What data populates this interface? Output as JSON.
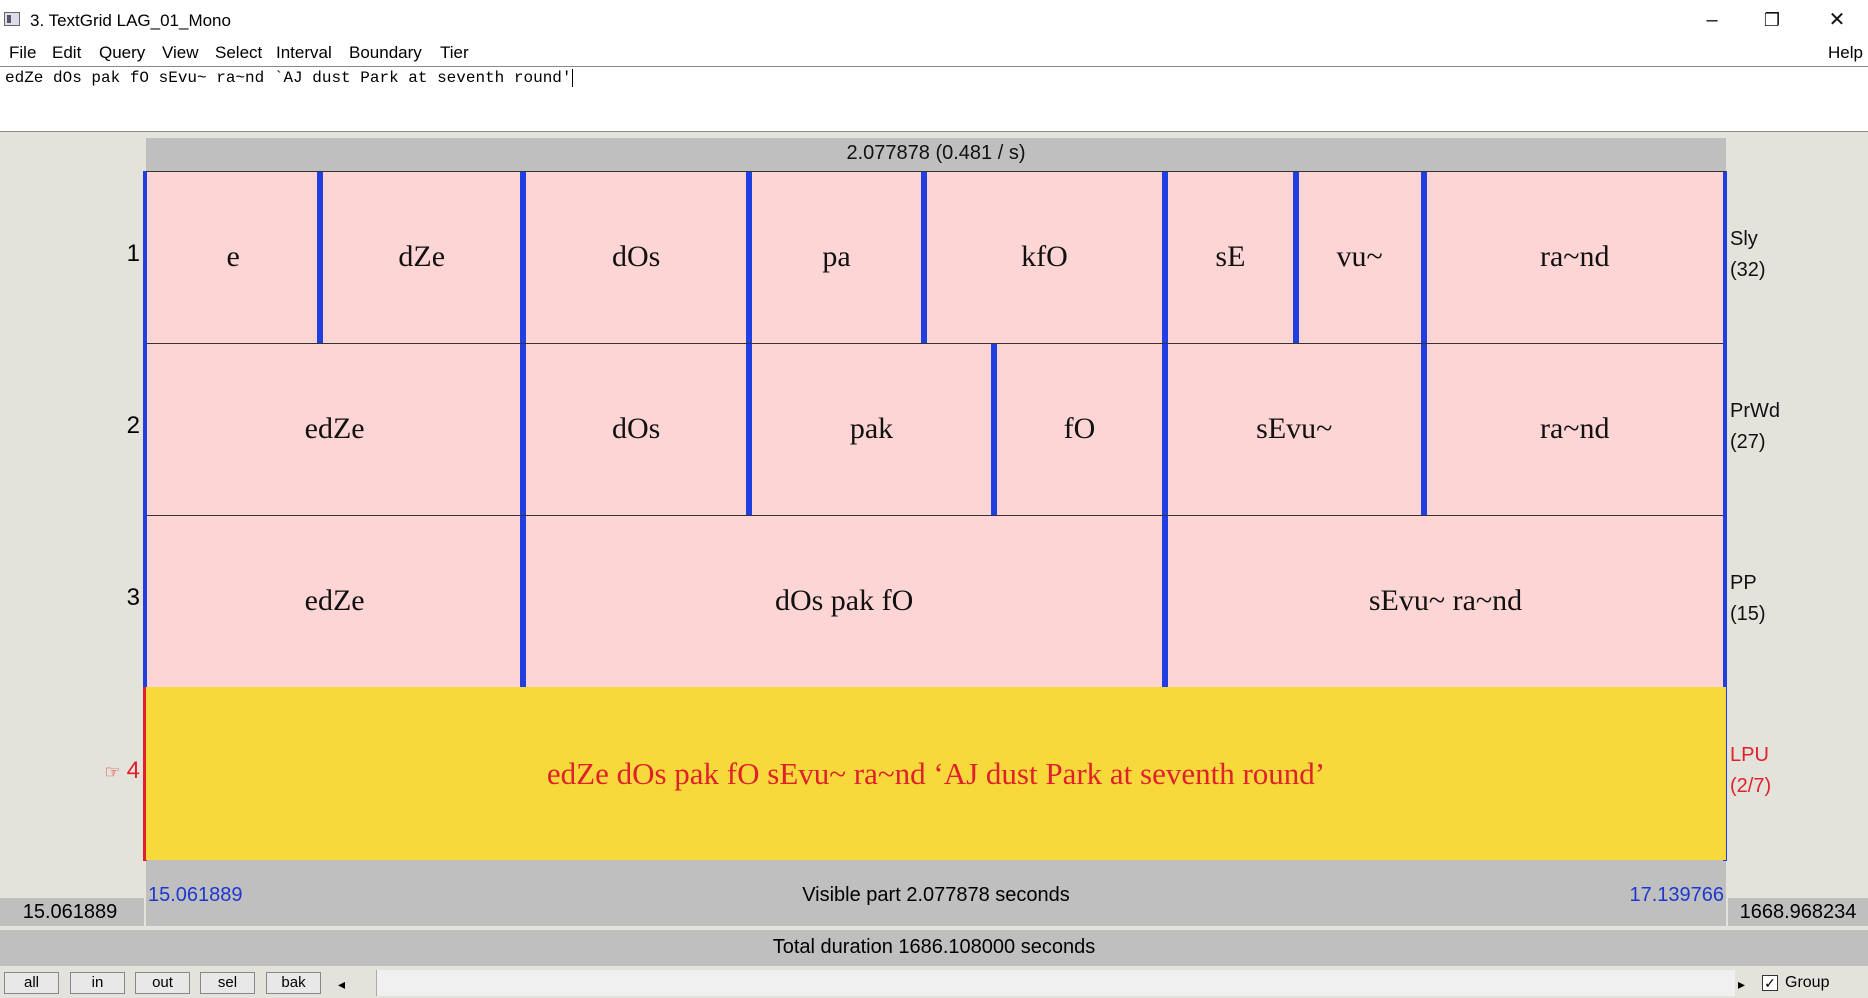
{
  "window": {
    "title": "3. TextGrid LAG_01_Mono",
    "minimize": "–",
    "restore": "❐",
    "close": "✕",
    "help": "Help"
  },
  "menu": [
    "File",
    "Edit",
    "Query",
    "View",
    "Select",
    "Interval",
    "Boundary",
    "Tier"
  ],
  "textbox": {
    "value": "edZe dOs pak fO sEvu~ ra~nd `AJ dust Park at seventh round'"
  },
  "header": {
    "duration_label": "2.077878 (0.481 / s)"
  },
  "tiers": [
    {
      "number": "1",
      "name": "Sly",
      "count": "(32)",
      "intervals": [
        {
          "text": "e",
          "start": 15.061889,
          "end": 15.291
        },
        {
          "text": "dZe",
          "start": 15.291,
          "end": 15.558
        },
        {
          "text": "dOs",
          "start": 15.558,
          "end": 15.855
        },
        {
          "text": "pa",
          "start": 15.855,
          "end": 16.085
        },
        {
          "text": "kfO",
          "start": 16.085,
          "end": 16.402
        },
        {
          "text": "sE",
          "start": 16.402,
          "end": 16.574
        },
        {
          "text": "vu~",
          "start": 16.574,
          "end": 16.742
        },
        {
          "text": "ra~nd",
          "start": 16.742,
          "end": 17.139766
        }
      ]
    },
    {
      "number": "2",
      "name": "PrWd",
      "count": "(27)",
      "intervals": [
        {
          "text": "edZe",
          "start": 15.061889,
          "end": 15.558
        },
        {
          "text": "dOs",
          "start": 15.558,
          "end": 15.855
        },
        {
          "text": "pak",
          "start": 15.855,
          "end": 16.177
        },
        {
          "text": "fO",
          "start": 16.177,
          "end": 16.402
        },
        {
          "text": "sEvu~",
          "start": 16.402,
          "end": 16.742
        },
        {
          "text": "ra~nd",
          "start": 16.742,
          "end": 17.139766
        }
      ]
    },
    {
      "number": "3",
      "name": "PP",
      "count": "(15)",
      "intervals": [
        {
          "text": "edZe",
          "start": 15.061889,
          "end": 15.558
        },
        {
          "text": "dOs pak fO",
          "start": 15.558,
          "end": 16.402
        },
        {
          "text": "sEvu~ ra~nd",
          "start": 16.402,
          "end": 17.139766
        }
      ]
    },
    {
      "number": "4",
      "name": "LPU",
      "count": "(2/7)",
      "selected": true,
      "pointer": "☞",
      "intervals": [
        {
          "text": "edZe dOs pak fO sEvu~ ra~nd ‘AJ dust Park at seventh round’",
          "start": 15.061889,
          "end": 17.139766
        }
      ]
    }
  ],
  "view": {
    "start": 15.061889,
    "end": 17.139766,
    "start_label": "15.061889",
    "end_label": "17.139766",
    "visible_label": "Visible part 2.077878 seconds",
    "left_total": "15.061889",
    "right_total": "1668.968234",
    "total_label": "Total duration 1686.108000 seconds"
  },
  "buttons": [
    "all",
    "in",
    "out",
    "sel",
    "bak"
  ],
  "scroll": {
    "left_arrow": "◂",
    "right_arrow": "▸"
  },
  "group": {
    "label": "Group",
    "checked": true,
    "check_mark": "✓"
  },
  "colors": {
    "interval_fill": "#fdd5d5",
    "selected_tier_fill": "#f8d93c",
    "boundary": "#1f3fe0",
    "selected_text": "#e0202a"
  }
}
